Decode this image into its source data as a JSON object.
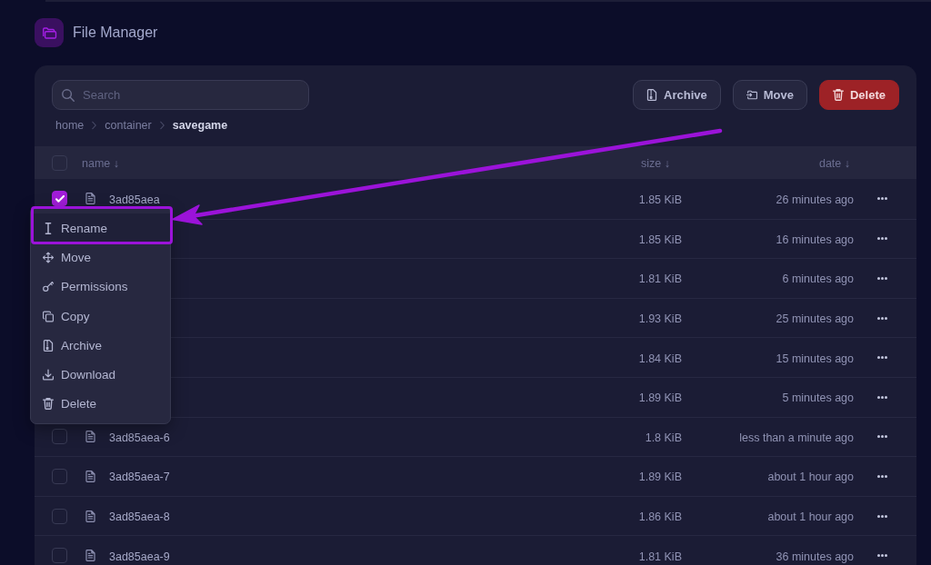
{
  "app": {
    "title": "File Manager"
  },
  "search": {
    "placeholder": "Search"
  },
  "breadcrumb": [
    {
      "label": "home",
      "current": false
    },
    {
      "label": "container",
      "current": false
    },
    {
      "label": "savegame",
      "current": true
    }
  ],
  "toolbar_buttons": [
    {
      "label": "Archive",
      "kind": "archive"
    },
    {
      "label": "Move",
      "kind": "move"
    },
    {
      "label": "Delete",
      "kind": "delete"
    }
  ],
  "table": {
    "select_all": {
      "checked": false
    },
    "columns": [
      "name ↓",
      "size ↓",
      "date ↓"
    ],
    "rows": [
      {
        "name": "3ad85aea",
        "size": "1.85 KiB",
        "date": "26 minutes ago",
        "selected": true
      },
      {
        "size": "1.85 KiB",
        "date": "16 minutes ago"
      },
      {
        "size": "1.81 KiB",
        "date": "6 minutes ago"
      },
      {
        "size": "1.93 KiB",
        "date": "25 minutes ago"
      },
      {
        "size": "1.84 KiB",
        "date": "15 minutes ago"
      },
      {
        "size": "1.89 KiB",
        "date": "5 minutes ago"
      },
      {
        "name": "3ad85aea-6",
        "size": "1.8 KiB",
        "date": "less than a minute ago",
        "selected": false
      },
      {
        "name": "3ad85aea-7",
        "size": "1.89 KiB",
        "date": "about 1 hour ago",
        "selected": false
      },
      {
        "name": "3ad85aea-8",
        "size": "1.86 KiB",
        "date": "about 1 hour ago",
        "selected": false
      },
      {
        "name": "3ad85aea-9",
        "size": "1.81 KiB",
        "date": "36 minutes ago",
        "selected": false
      }
    ]
  },
  "context_menu": {
    "items": [
      {
        "label": "Rename",
        "kind": "rename",
        "highlighted": true
      },
      {
        "label": "Move",
        "kind": "move",
        "highlighted": false
      },
      {
        "label": "Permissions",
        "kind": "permissions",
        "highlighted": false
      },
      {
        "label": "Copy",
        "kind": "copy",
        "highlighted": false
      },
      {
        "label": "Archive",
        "kind": "archive",
        "highlighted": false
      },
      {
        "label": "Download",
        "kind": "download",
        "highlighted": false
      },
      {
        "label": "Delete",
        "kind": "delete",
        "highlighted": false
      }
    ]
  }
}
